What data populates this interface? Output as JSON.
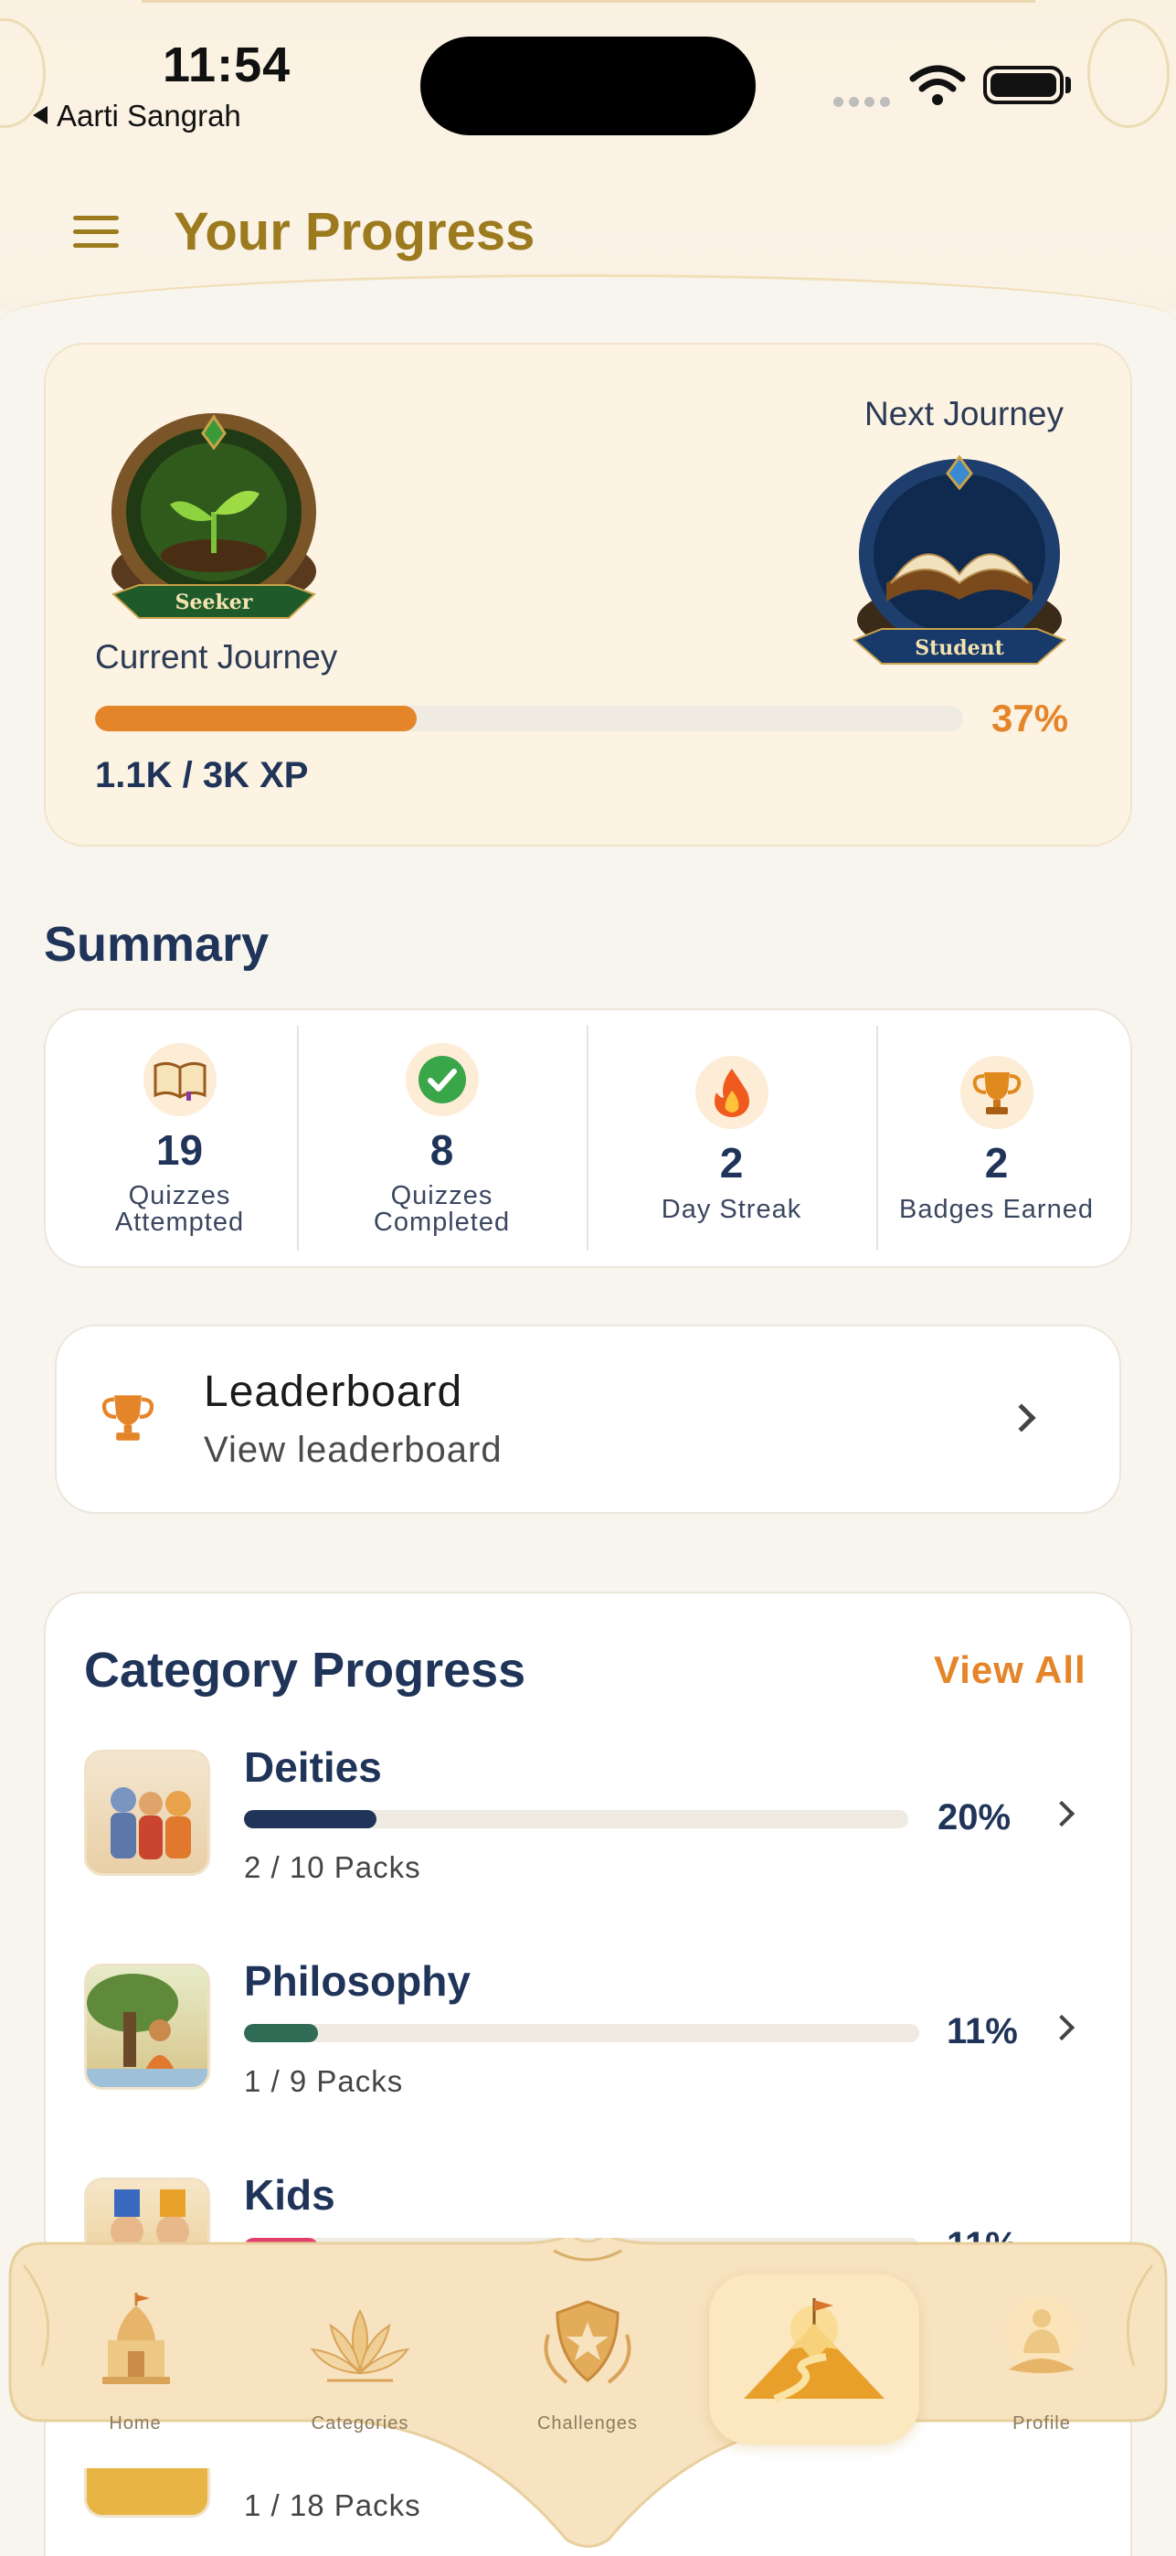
{
  "status_bar": {
    "time": "11:54",
    "back_label": "Aarti Sangrah"
  },
  "header": {
    "title": "Your Progress"
  },
  "journey": {
    "current_label": "Current Journey",
    "next_label": "Next Journey",
    "current_badge": "Seeker",
    "next_badge": "Student",
    "progress_percent_text": "37%",
    "progress_fraction": 0.37,
    "xp_text": "1.1K / 3K XP"
  },
  "summary": {
    "title": "Summary",
    "stats": [
      {
        "value": "19",
        "label_line1": "Quizzes",
        "label_line2": "Attempted",
        "icon": "book-icon"
      },
      {
        "value": "8",
        "label_line1": "Quizzes",
        "label_line2": "Completed",
        "icon": "check-circle-icon"
      },
      {
        "value": "2",
        "label_line1": "Day Streak",
        "label_line2": "",
        "icon": "flame-icon"
      },
      {
        "value": "2",
        "label_line1": "Badges Earned",
        "label_line2": "",
        "icon": "trophy-icon"
      }
    ]
  },
  "leaderboard": {
    "title": "Leaderboard",
    "subtitle": "View leaderboard"
  },
  "category_progress": {
    "title": "Category Progress",
    "view_all": "View All",
    "items": [
      {
        "name": "Deities",
        "percent_text": "20%",
        "fraction": 0.2,
        "packs": "2 / 10 Packs",
        "color": "#1f3458"
      },
      {
        "name": "Philosophy",
        "percent_text": "11%",
        "fraction": 0.11,
        "packs": "1 / 9 Packs",
        "color": "#2f6b55"
      },
      {
        "name": "Kids",
        "percent_text": "11%",
        "fraction": 0.11,
        "packs": "",
        "color": "#e0406a"
      }
    ],
    "partial_last_packs": "1 / 18 Packs"
  },
  "bottom_nav": {
    "items": [
      {
        "label": "Home",
        "icon": "temple-icon"
      },
      {
        "label": "Categories",
        "icon": "lotus-icon"
      },
      {
        "label": "Challenges",
        "icon": "shield-star-icon"
      },
      {
        "label": "",
        "icon": "mountain-flag-icon"
      },
      {
        "label": "Profile",
        "icon": "meditation-icon"
      }
    ],
    "active_index": 3
  },
  "colors": {
    "accent_orange": "#e5852a",
    "title_gold": "#9c7a1e",
    "navy": "#1f3458"
  }
}
